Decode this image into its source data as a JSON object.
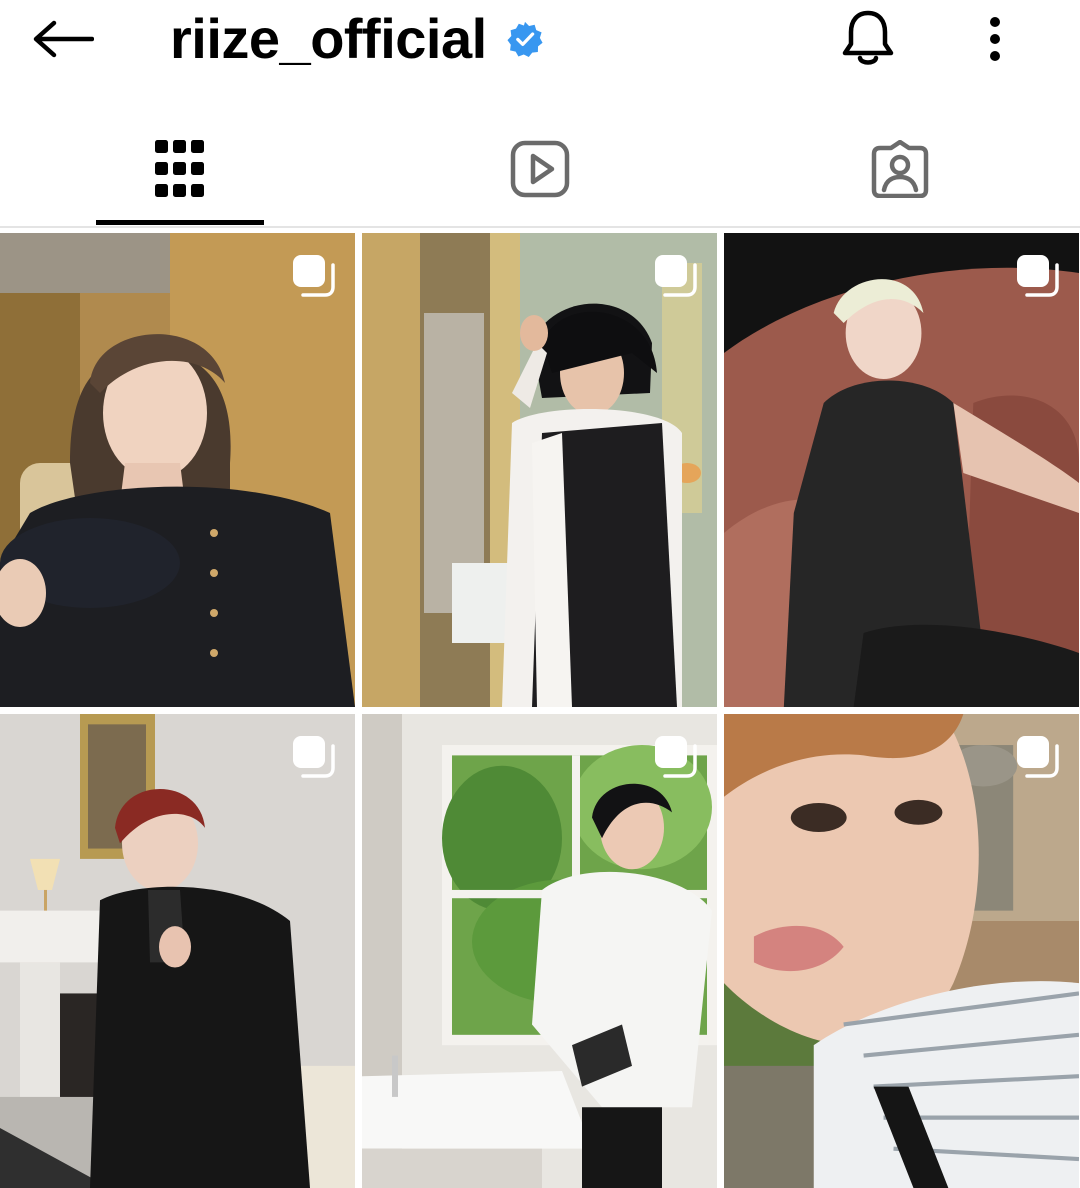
{
  "header": {
    "back_icon": "arrow-left-icon",
    "username": "riize_official",
    "verified_icon": "verified-badge-icon",
    "notification_icon": "bell-icon",
    "more_icon": "more-vertical-icon",
    "accent_color": "#3897f0"
  },
  "tabs": [
    {
      "icon": "grid-icon",
      "active": true
    },
    {
      "icon": "reels-icon",
      "active": false
    },
    {
      "icon": "tagged-icon",
      "active": false
    }
  ],
  "posts": [
    {
      "type": "carousel",
      "icon": "carousel-icon"
    },
    {
      "type": "carousel",
      "icon": "carousel-icon"
    },
    {
      "type": "carousel",
      "icon": "carousel-icon"
    },
    {
      "type": "carousel",
      "icon": "carousel-icon"
    },
    {
      "type": "carousel",
      "icon": "carousel-icon"
    },
    {
      "type": "carousel",
      "icon": "carousel-icon"
    }
  ]
}
